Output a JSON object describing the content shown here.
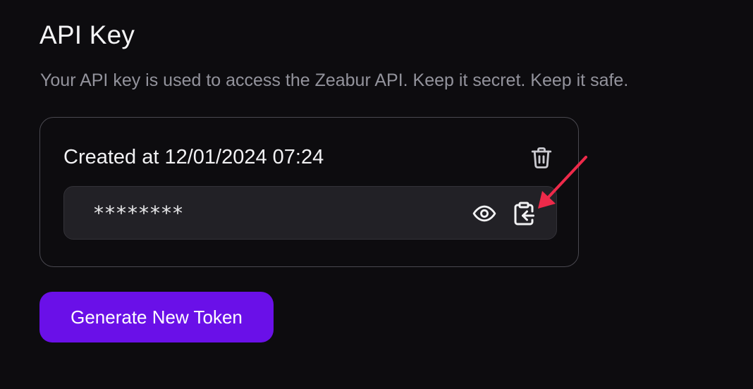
{
  "api_key_section": {
    "title": "API Key",
    "description": "Your API key is used to access the Zeabur API. Keep it secret. Keep it safe."
  },
  "token_card": {
    "created_label": "Created at 12/01/2024 07:24",
    "masked_key": "********",
    "icons": {
      "delete": "trash-icon",
      "reveal": "eye-icon",
      "copy": "clipboard-copy-icon"
    }
  },
  "annotation": {
    "arrow_color": "#ee2a4a",
    "points_to": "clipboard-copy-icon"
  },
  "actions": {
    "generate_label": "Generate New Token",
    "generate_color": "#6a10e8"
  }
}
